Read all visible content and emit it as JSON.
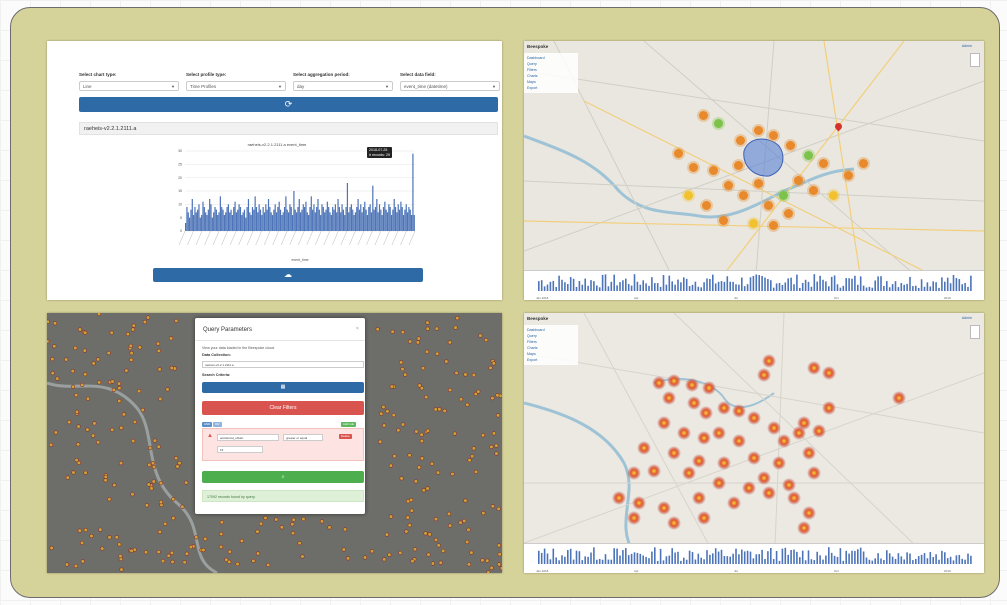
{
  "panel1": {
    "controls": [
      {
        "label": "Select chart type:",
        "value": "Line"
      },
      {
        "label": "Select profile type:",
        "value": "Time Profiles"
      },
      {
        "label": "Select aggregation period:",
        "value": "day"
      },
      {
        "label": "Select data field:",
        "value": "event_time (datetime)"
      }
    ],
    "refresh_icon": "refresh-icon",
    "section_title": "raeheis-v2.2.1.2111.a",
    "chart_title": "raeheis-v2.2.1.2111.a event_time",
    "tooltip_date": "2018-07-25",
    "tooltip_value": "# records: 29",
    "xlabel": "event_time",
    "download_icon": "cloud-download-icon"
  },
  "chart_data": {
    "type": "bar",
    "title": "raeheis-v2.2.1.2111.a event_time",
    "xlabel": "event_time",
    "ylabel": "",
    "ylim": [
      0,
      30
    ],
    "yticks": [
      "0",
      "5",
      "10",
      "15",
      "20",
      "25",
      "30"
    ],
    "values": [
      3,
      9,
      7,
      5,
      8,
      12,
      6,
      9,
      7,
      8,
      10,
      5,
      6,
      11,
      9,
      7,
      6,
      8,
      12,
      10,
      5,
      7,
      9,
      8,
      6,
      7,
      13,
      9,
      8,
      6,
      7,
      9,
      10,
      7,
      8,
      6,
      9,
      11,
      7,
      8,
      10,
      9,
      6,
      7,
      8,
      5,
      9,
      12,
      7,
      6,
      9,
      8,
      13,
      9,
      7,
      10,
      8,
      6,
      9,
      7,
      10,
      8,
      12,
      9,
      7,
      6,
      8,
      10,
      7,
      9,
      11,
      8,
      6,
      7,
      9,
      13,
      8,
      7,
      10,
      9,
      6,
      15,
      8,
      7,
      9,
      12,
      7,
      8,
      10,
      9,
      11,
      7,
      6,
      9,
      13,
      8,
      10,
      7,
      9,
      12,
      8,
      6,
      10,
      9,
      7,
      8,
      11,
      9,
      7,
      6,
      9,
      8,
      10,
      7,
      12,
      9,
      7,
      10,
      8,
      6,
      9,
      18,
      7,
      9,
      10,
      8,
      6,
      7,
      9,
      12,
      8,
      10,
      7,
      9,
      11,
      8,
      6,
      9,
      10,
      7,
      17,
      8,
      9,
      12,
      7,
      10,
      8,
      6,
      9,
      11,
      8,
      7,
      10,
      9,
      6,
      8,
      12,
      9,
      7,
      10,
      8,
      11,
      9,
      6,
      8,
      10,
      7,
      9,
      8,
      6,
      29,
      6
    ]
  },
  "panel2": {
    "app_name": "Beespoke",
    "nav_items": [
      "Dashboard",
      "Query",
      "Filters",
      "Charts",
      "Maps",
      "Export"
    ],
    "user_menu": "Admin",
    "colors": {
      "cluster_orange": "#e8892b",
      "cluster_green": "#7dc24b",
      "cluster_yellow": "#f2c12e",
      "polygon": "#4a78d6",
      "pin": "#d6342b"
    },
    "timeline_labels": [
      "Jan 2018",
      "Apr",
      "Jul",
      "Oct",
      "2019"
    ]
  },
  "panel3": {
    "modal_title": "Query Parameters",
    "close_glyph": "×",
    "description": "View your data loaded in the Beespoke cloud.",
    "data_collection_label": "Data Collection:",
    "data_collection_value": "raeheis-v2.2.1.2111.a",
    "search_criteria_label": "Search Criteria:",
    "calendar_icon": "calendar-icon",
    "clear_filters": "Clear Filters",
    "chip_and": "AND",
    "chip_or": "OR",
    "add_rule": "Add rule",
    "delete_rule": "Delete",
    "field_value": "accidental_obtain",
    "operator_value": "greater or equal",
    "filter_input": "15",
    "search_icon": "search-icon",
    "result_text": "17092 records found by query."
  },
  "panel4": {
    "app_name": "Beespoke",
    "nav_items": [
      "Dashboard",
      "Query",
      "Filters",
      "Charts",
      "Maps",
      "Export"
    ],
    "user_menu": "Admin",
    "colors": {
      "heat_core": "#f7d43a",
      "heat_mid": "#e2572f",
      "heat_edge": "#b23b3b"
    },
    "timeline_labels": [
      "Jan 2018",
      "Apr",
      "Jul",
      "Oct",
      "2019"
    ]
  }
}
